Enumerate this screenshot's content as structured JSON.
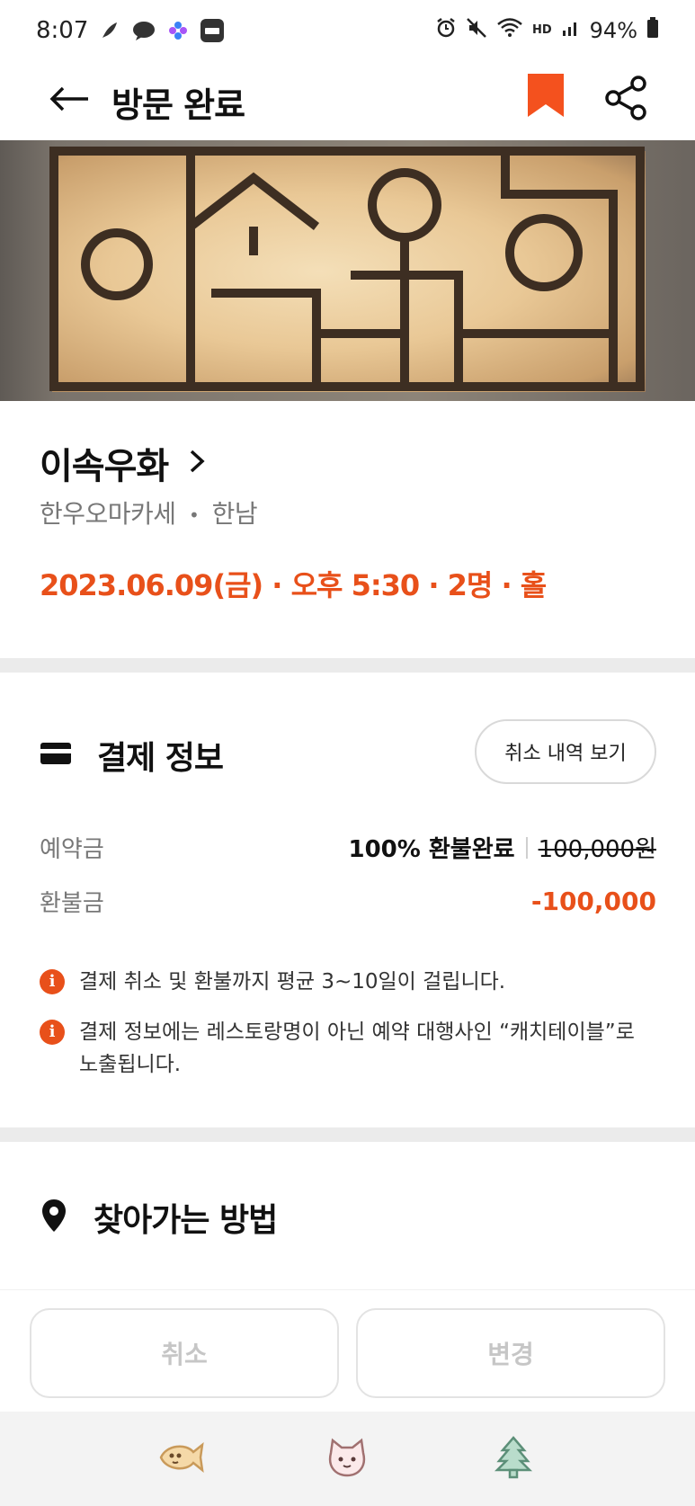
{
  "status_bar": {
    "time": "8:07",
    "battery": "94%",
    "hd_label": "HD"
  },
  "app_bar": {
    "title": "방문 완료",
    "back_icon": "arrow-left-icon",
    "bookmark_icon": "bookmark-icon",
    "share_icon": "share-icon",
    "accent_color": "#F4511E"
  },
  "restaurant": {
    "name": "이속우화",
    "category": "한우오마카세",
    "separator": "•",
    "area": "한남",
    "booking_summary": "2023.06.09(금) · 오후 5:30 · 2명 · 홀"
  },
  "payment": {
    "title": "결제 정보",
    "cancel_history_label": "취소 내역 보기",
    "deposit_label": "예약금",
    "refund_status": "100% 환불완료",
    "original_amount": "100,000원",
    "refund_label": "환불금",
    "refund_amount": "-100,000",
    "notices": [
      "결제 취소 및 환불까지 평균 3~10일이 걸립니다.",
      "결제 정보에는 레스토랑명이 아닌 예약 대행사인 “캐치테이블”로 노출됩니다."
    ],
    "notice_icon": "i"
  },
  "directions": {
    "title": "찾아가는 방법"
  },
  "actions": {
    "cancel_label": "취소",
    "change_label": "변경"
  },
  "bottom_nav": {
    "items": [
      "fish-icon",
      "cat-icon",
      "tree-icon"
    ]
  }
}
